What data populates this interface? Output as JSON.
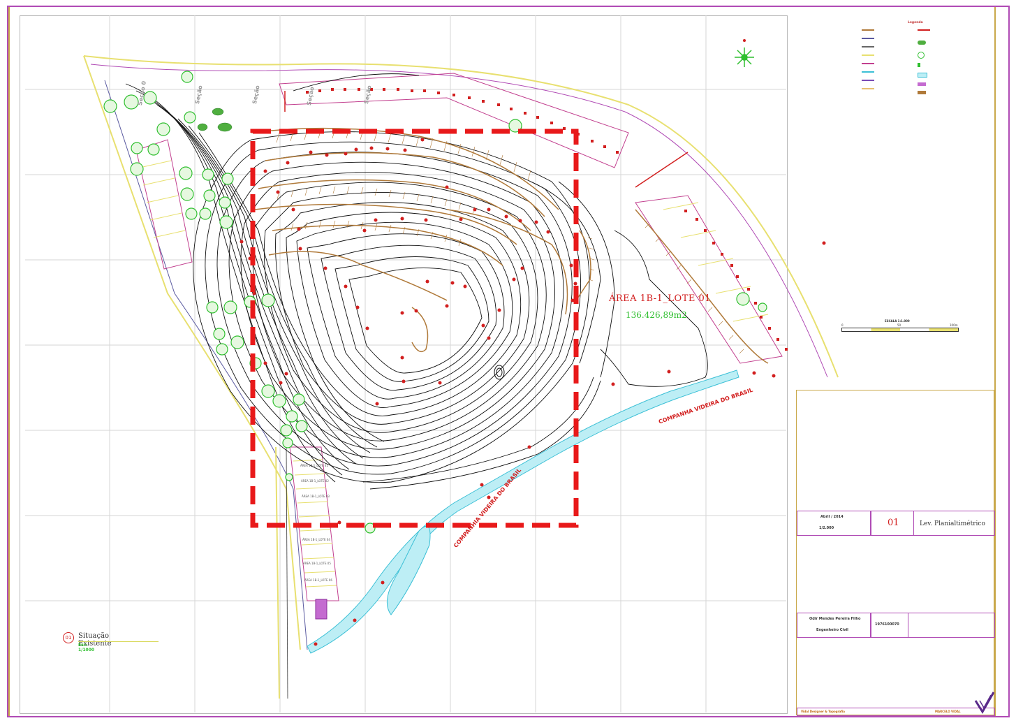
{
  "map": {
    "area_title": "ÁREA 1B-1_LOTE 01",
    "area_value": "136.426,89m2",
    "company_label_1": "COMPANHA VIDEIRA DO BRASIL",
    "company_label_2": "COMPANHIA VIDEIRA DO BRASIL",
    "section_labels": [
      "Seção 0",
      "Seção",
      "Seção",
      "Seção",
      "Seção"
    ],
    "lot_labels": [
      "ÁREA 1B-1_LOTE 01",
      "ÁREA 1B-1_LOTE 02",
      "ÁREA 1B-1_LOTE 03",
      "ÁREA 1B-1_LOTE 04",
      "ÁREA 1B-1_LOTE 05",
      "ÁREA 1B-1_LOTE 06"
    ]
  },
  "legend": {
    "title": "Legenda"
  },
  "scale": {
    "title": "ESCALA 1:1.000",
    "ticks": [
      "0",
      "50",
      "100m"
    ]
  },
  "situation": {
    "number": "01",
    "title": "Situação Existente",
    "scale": "Esc: 1/1000"
  },
  "title_block": {
    "date": "Abril / 2014",
    "scale": "1/2.000",
    "sheet_number": "01",
    "drawing_title": "Lev. Planialtimétrico",
    "engineer": "Odir Mendes Pereira Filho",
    "engineer_role": "Engenheiro Civil",
    "crea": "1976100070",
    "footer_left": "Vidal Designer & Topografia",
    "footer_right": "MARCELO VIDAL"
  },
  "colors": {
    "border": "#b04bb5",
    "highlight_box": "#e8191a",
    "contour": "#111111",
    "terrace": "#b07a3a",
    "tree": "#2fbf2f",
    "river": "#5fd0e0",
    "road_edge": "#e8e070"
  }
}
